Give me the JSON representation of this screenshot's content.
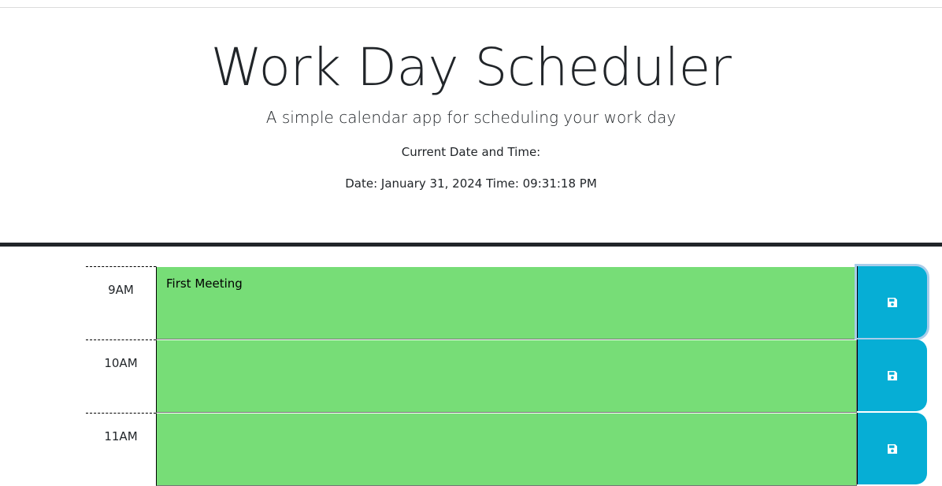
{
  "header": {
    "title": "Work Day Scheduler",
    "lead": "A simple calendar app for scheduling your work day",
    "clock_label": "Current Date and Time:",
    "clock_value": "Date: January 31, 2024 Time: 09:31:18 PM"
  },
  "colors": {
    "present_row": "#77dd77",
    "save_button": "#06aed5",
    "divider": "#212529"
  },
  "rows": [
    {
      "hour": "9AM",
      "text": "First Meeting",
      "save_icon": "save-icon"
    },
    {
      "hour": "10AM",
      "text": "",
      "save_icon": "save-icon"
    },
    {
      "hour": "11AM",
      "text": "",
      "save_icon": "save-icon"
    }
  ]
}
